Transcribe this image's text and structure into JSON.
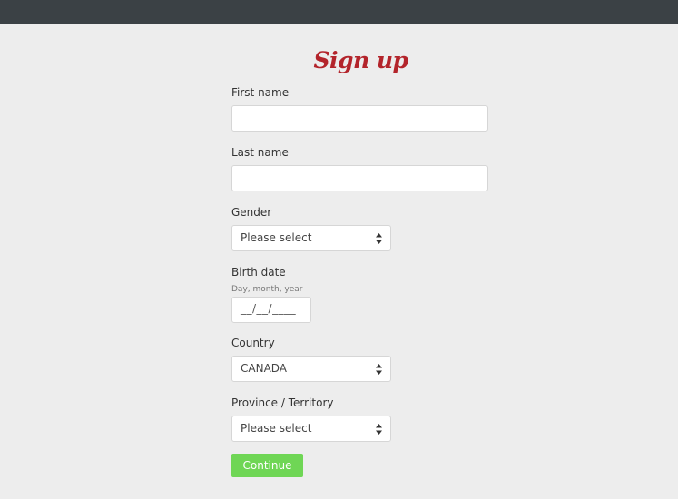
{
  "title": "Sign up",
  "fields": {
    "first_name": {
      "label": "First name",
      "value": ""
    },
    "last_name": {
      "label": "Last name",
      "value": ""
    },
    "gender": {
      "label": "Gender",
      "selected": "Please select"
    },
    "birth_date": {
      "label": "Birth date",
      "hint": "Day, month, year",
      "value": "__/__/____"
    },
    "country": {
      "label": "Country",
      "selected": "CANADA"
    },
    "province": {
      "label": "Province / Territory",
      "selected": "Please select"
    }
  },
  "continue_label": "Continue",
  "colors": {
    "topbar": "#3b4145",
    "title": "#b3242b",
    "button": "#6fd655"
  },
  "icons": {
    "select_arrow": "updown-caret-icon"
  }
}
